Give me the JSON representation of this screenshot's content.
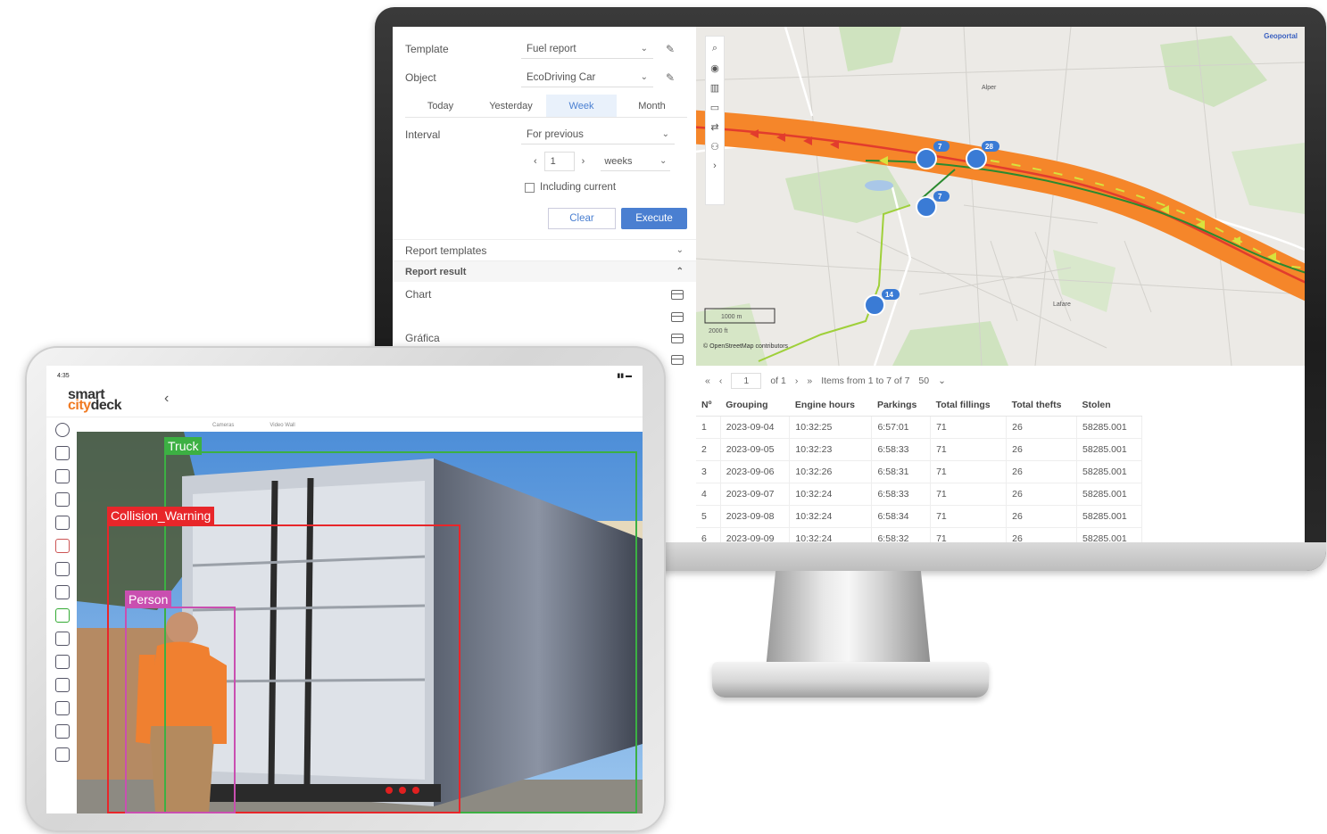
{
  "monitor": {
    "report_panel": {
      "template_label": "Template",
      "template_value": "Fuel report",
      "object_label": "Object",
      "object_value": "EcoDriving Car",
      "period_tabs": [
        "Today",
        "Yesterday",
        "Week",
        "Month"
      ],
      "active_period": "Week",
      "interval_label": "Interval",
      "interval_value": "For previous",
      "interval_count": "1",
      "interval_unit": "weeks",
      "including_current_label": "Including current",
      "clear_label": "Clear",
      "execute_label": "Execute",
      "report_templates_label": "Report templates",
      "report_result_label": "Report result",
      "result_items": [
        "Chart",
        "",
        "Gráfica"
      ]
    },
    "map": {
      "attribution": "© OpenStreetMap contributors",
      "corner_text": "Geoportal",
      "scale_1": "1000 m",
      "scale_2": "2000 ft",
      "markers": [
        "7",
        "28",
        "7",
        "14"
      ],
      "places": [
        "Lafare",
        "Alper"
      ]
    },
    "pager": {
      "first": "«",
      "prev": "‹",
      "page": "1",
      "of": "of 1",
      "next": "›",
      "last": "»",
      "items_text": "Items from 1 to 7 of 7",
      "per_page": "50"
    },
    "table": {
      "headers": [
        "Nº",
        "Grouping",
        "Engine hours",
        "Parkings",
        "Total fillings",
        "Total thefts",
        "Stolen"
      ],
      "rows": [
        [
          "1",
          "2023-09-04",
          "10:32:25",
          "6:57:01",
          "71",
          "26",
          "58285.001"
        ],
        [
          "2",
          "2023-09-05",
          "10:32:23",
          "6:58:33",
          "71",
          "26",
          "58285.001"
        ],
        [
          "3",
          "2023-09-06",
          "10:32:26",
          "6:58:31",
          "71",
          "26",
          "58285.001"
        ],
        [
          "4",
          "2023-09-07",
          "10:32:24",
          "6:58:33",
          "71",
          "26",
          "58285.001"
        ],
        [
          "5",
          "2023-09-08",
          "10:32:24",
          "6:58:34",
          "71",
          "26",
          "58285.001"
        ],
        [
          "6",
          "2023-09-09",
          "10:32:24",
          "6:58:32",
          "71",
          "26",
          "58285.001"
        ]
      ]
    }
  },
  "tablet": {
    "status_time": "4:35",
    "logo_smart": "smart",
    "logo_city": "city",
    "logo_deck": "deck",
    "back_icon": "chevron-left-icon",
    "tabs": [
      "Cameras",
      "Video Wall"
    ],
    "detections": {
      "truck": "Truck",
      "collision": "Collision_Warning",
      "person": "Person"
    },
    "colors": {
      "truck": "#3cb043",
      "collision": "#e8262a",
      "person": "#c94fb0",
      "route_orange": "#f5862a",
      "accent_blue": "#4a7fd1"
    }
  }
}
